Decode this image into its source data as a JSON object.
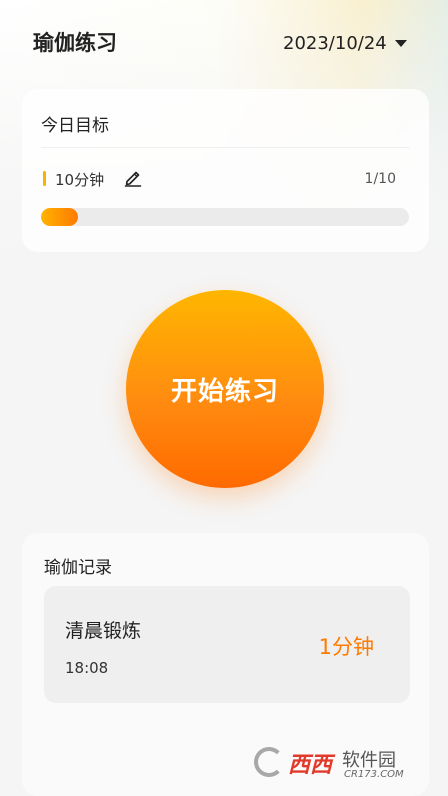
{
  "header": {
    "title": "瑜伽练习",
    "date": "2023/10/24"
  },
  "goal": {
    "title": "今日目标",
    "target": "10分钟",
    "count": "1/10",
    "progress": 0.1
  },
  "start_button": {
    "label": "开始练习"
  },
  "records": {
    "title": "瑜伽记录",
    "items": [
      {
        "name": "清晨锻炼",
        "time": "18:08",
        "duration": "1分钟"
      }
    ]
  },
  "watermark": {
    "brand": "西西",
    "text": "软件园",
    "domain": "CR173.COM"
  },
  "colors": {
    "accent": "#ff7a00",
    "marker": "#f5b400"
  }
}
